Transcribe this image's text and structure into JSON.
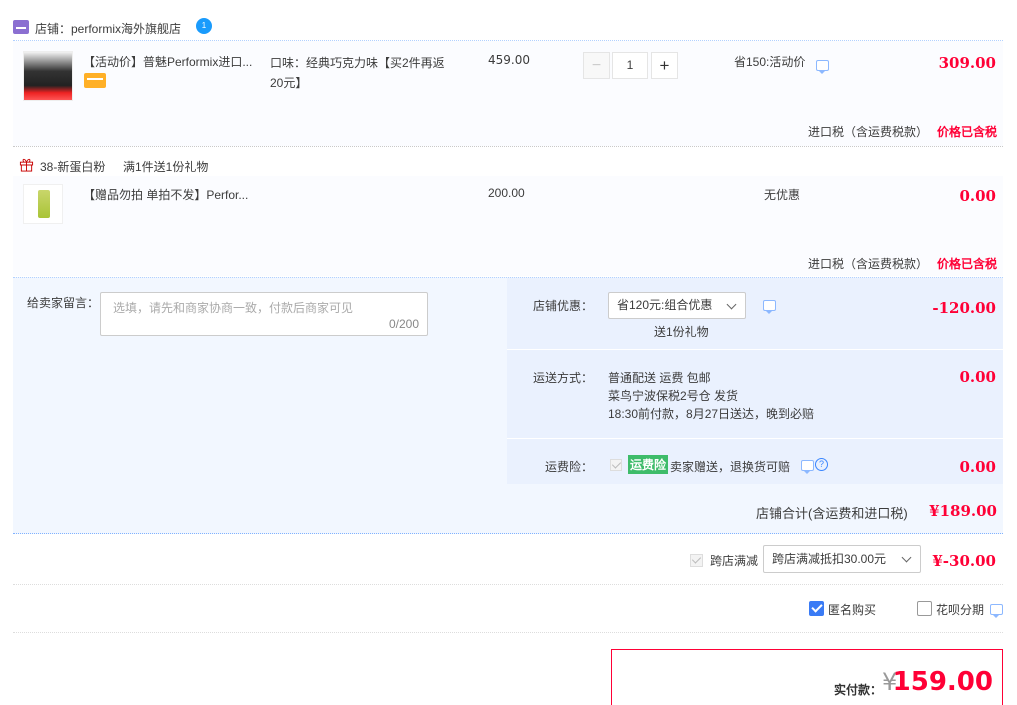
{
  "shop": {
    "label": "店铺：performix海外旗舰店",
    "ww": "1"
  },
  "item1": {
    "title": "【活动价】普魅Performix进口...",
    "sku": "口味：经典巧克力味【买2件再返20元】",
    "price": "459.00",
    "qty": "1",
    "minus": "−",
    "plus": "+",
    "discount": "省150:活动价",
    "total": "309.00",
    "tax_label": "进口税（含运费税款）",
    "tax_value": "价格已含税"
  },
  "gift": {
    "label": "38-新蛋白粉",
    "rule": "满1件送1份礼物"
  },
  "item2": {
    "title": "【赠品勿拍 单拍不发】Perfor...",
    "price": "200.00",
    "discount": "无优惠",
    "total": "0.00",
    "tax_label": "进口税（含运费税款）",
    "tax_value": "价格已含税"
  },
  "message": {
    "label": "给卖家留言：",
    "placeholder": "选填，请先和商家协商一致，付款后商家可见",
    "count": "0/200"
  },
  "coupon": {
    "label": "店铺优惠：",
    "selected": "省120元:组合优惠",
    "gift": "送1份礼物",
    "value": "-120.00"
  },
  "shipping": {
    "label": "运送方式：",
    "line1": "普通配送 运费 包邮",
    "line2": "菜鸟宁波保税2号仓   发货",
    "line3": "18:30前付款，8月27日送达，晚到必赔",
    "value": "0.00"
  },
  "insurance": {
    "label": "运费险：",
    "badge": "运费险",
    "text": "卖家赠送，退换货可赔",
    "help": "?",
    "value": "0.00"
  },
  "shop_total": {
    "label": "店铺合计(含运费和进口税)",
    "value": "¥189.00"
  },
  "cross_store": {
    "label": "跨店满减",
    "selected": "跨店满减抵扣30.00元",
    "value": "¥-30.00"
  },
  "options": {
    "anonymous": "匿名购买",
    "huabei": "花呗分期"
  },
  "payment": {
    "label": "实付款：",
    "yen": "¥",
    "value": "159.00"
  }
}
